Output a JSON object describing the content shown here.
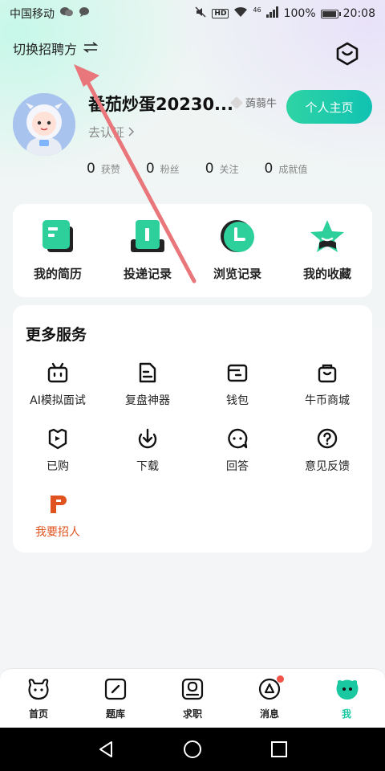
{
  "status_bar": {
    "carrier": "中国移动",
    "network": "46",
    "battery": "100%",
    "battery_level": 1.0,
    "time": "20:08"
  },
  "header": {
    "switch_role_label": "切换招聘方",
    "switch_icon": "swap-arrows-icon",
    "settings_icon": "hexagon-settings-icon"
  },
  "profile": {
    "username": "番茄炒蛋20230...",
    "vip_label": "蒟蒻牛",
    "homepage_button": "个人主页",
    "verify_label": "去认证",
    "avatar": "astronaut-avatar"
  },
  "stats": [
    {
      "value": "0",
      "label": "获赞"
    },
    {
      "value": "0",
      "label": "粉丝"
    },
    {
      "value": "0",
      "label": "关注"
    },
    {
      "value": "0",
      "label": "成就值"
    }
  ],
  "quick_actions": [
    {
      "label": "我的简历",
      "icon": "resume-icon"
    },
    {
      "label": "投递记录",
      "icon": "delivery-record-icon"
    },
    {
      "label": "浏览记录",
      "icon": "browse-history-icon"
    },
    {
      "label": "我的收藏",
      "icon": "favorites-star-icon"
    }
  ],
  "services": {
    "title": "更多服务",
    "items": [
      {
        "label": "AI模拟面试",
        "icon": "robot-icon"
      },
      {
        "label": "复盘神器",
        "icon": "document-icon"
      },
      {
        "label": "钱包",
        "icon": "wallet-icon"
      },
      {
        "label": "牛币商城",
        "icon": "shop-bag-icon"
      },
      {
        "label": "已购",
        "icon": "purchased-shield-icon"
      },
      {
        "label": "下载",
        "icon": "download-icon"
      },
      {
        "label": "回答",
        "icon": "answer-chat-icon"
      },
      {
        "label": "意见反馈",
        "icon": "feedback-question-icon"
      },
      {
        "label": "我要招人",
        "icon": "recruit-p-icon",
        "color": "#e0531f"
      }
    ]
  },
  "tabs": [
    {
      "label": "首页",
      "icon": "home-cow-icon",
      "active": false
    },
    {
      "label": "题库",
      "icon": "question-bank-icon",
      "active": false
    },
    {
      "label": "求职",
      "icon": "job-search-icon",
      "active": false
    },
    {
      "label": "消息",
      "icon": "message-icon",
      "active": false,
      "badge": true
    },
    {
      "label": "我",
      "icon": "me-face-icon",
      "active": true
    }
  ],
  "colors": {
    "accent": "#19c8a0",
    "recruit": "#e0531f",
    "badge": "#f2544a",
    "annotation_arrow": "#e8767a"
  }
}
